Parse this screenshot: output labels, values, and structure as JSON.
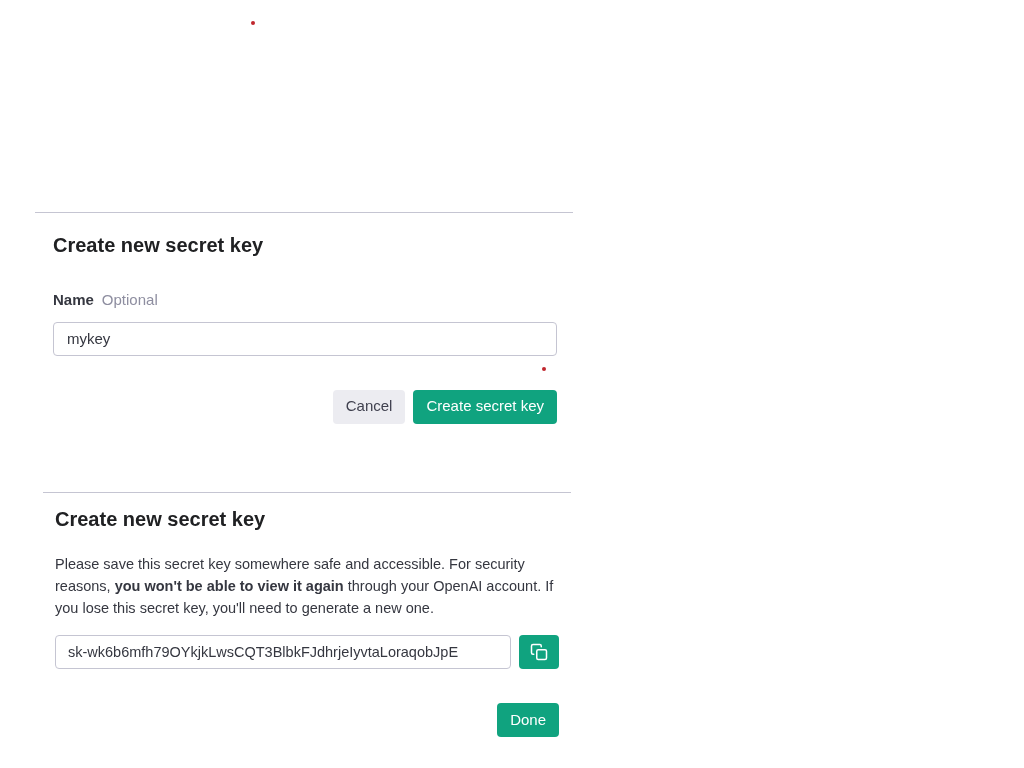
{
  "create_dialog": {
    "title": "Create new secret key",
    "field_label": "Name",
    "field_hint": "Optional",
    "field_value": "mykey",
    "buttons": [
      {
        "label": "Cancel",
        "kind": "secondary"
      },
      {
        "label": "Create secret key",
        "kind": "primary"
      }
    ]
  },
  "result_dialog": {
    "title": "Create new secret key",
    "message": "Please save this secret key somewhere safe and accessible. For security reasons, **you won't be able to view it again** through your OpenAI account. If you lose this secret key, you'll need to generate a new one.",
    "key_value": "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",
    "buttons": [
      {
        "label": "Done",
        "kind": "primary"
      }
    ]
  }
}
